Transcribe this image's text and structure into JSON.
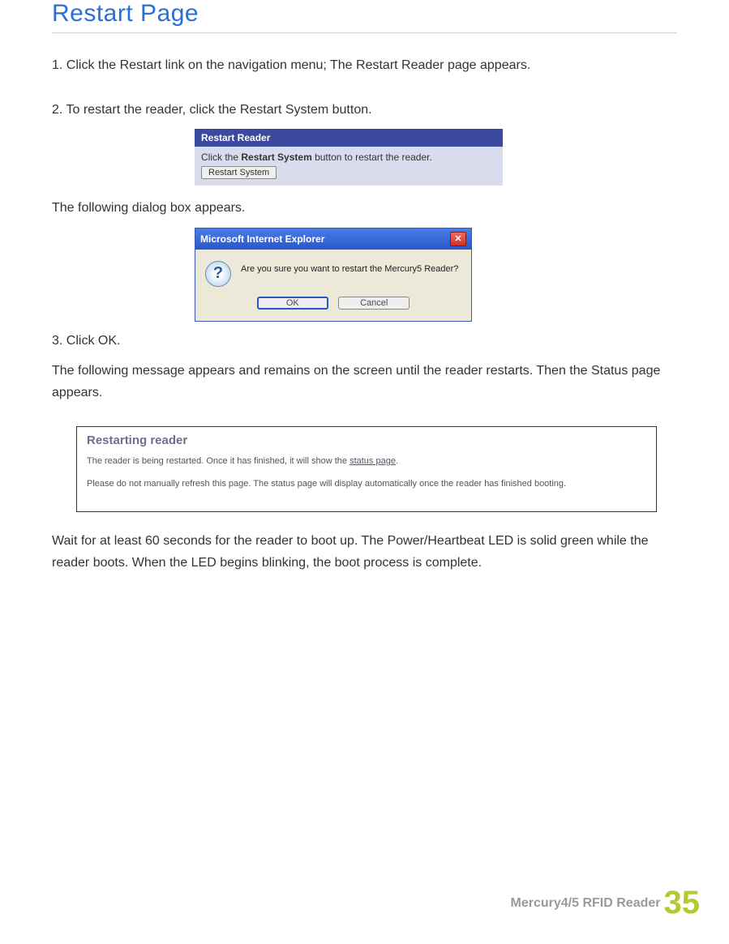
{
  "title": "Restart Page",
  "steps": {
    "s1": "1. Click the Restart link on the navigation menu; The Restart Reader page appears.",
    "s2": "2. To restart the reader, click the Restart System button.",
    "s_after_panel1": "The following dialog box appears.",
    "s3": "3. Click OK.",
    "s3b": "The following message appears and remains on the screen until the reader restarts. Then the Status page appears.",
    "wait": "Wait for at least 60 seconds for the reader to boot up. The Power/Heartbeat LED is solid green while the reader boots. When the LED begins blinking, the boot process is complete."
  },
  "panel1": {
    "title": "Restart Reader",
    "text_pre": "Click the ",
    "text_bold": "Restart System",
    "text_post": " button to restart the reader.",
    "button": "Restart System"
  },
  "iedlg": {
    "title": "Microsoft Internet Explorer",
    "msg": "Are you sure you want to restart the Mercury5 Reader?",
    "ok": "OK",
    "cancel": "Cancel"
  },
  "panel3": {
    "title": "Restarting reader",
    "line1a": "The reader is being restarted. Once it has finished, it will show the ",
    "line1_link": "status page",
    "line1b": ".",
    "line2": "Please do not manually refresh this page. The status page will display automatically once the reader has finished booting."
  },
  "footer": {
    "product": "Mercury4/5 RFID Reader",
    "page": "35"
  }
}
